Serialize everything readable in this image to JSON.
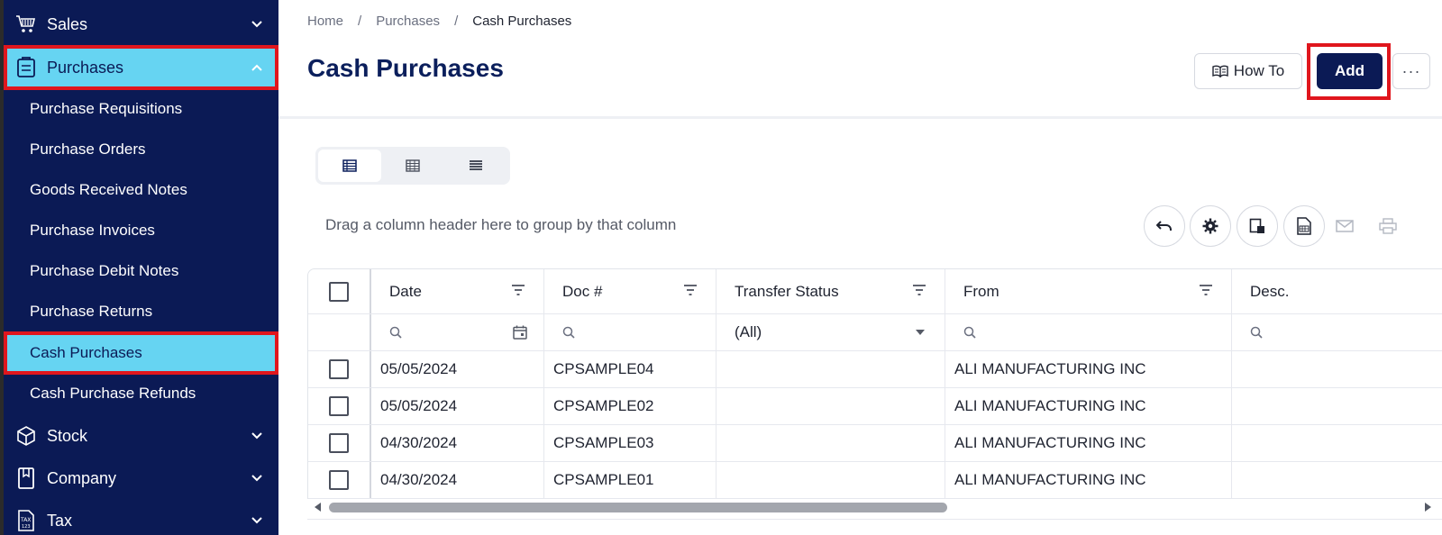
{
  "sidebar": {
    "sections": [
      {
        "label": "Sales",
        "icon": "cart-icon",
        "expanded": false
      },
      {
        "label": "Purchases",
        "icon": "clipboard-icon",
        "expanded": true,
        "active": true
      },
      {
        "label": "Stock",
        "icon": "box-icon",
        "expanded": false
      },
      {
        "label": "Company",
        "icon": "book-icon",
        "expanded": false
      },
      {
        "label": "Tax",
        "icon": "tax-icon",
        "expanded": false
      }
    ],
    "purchases_items": [
      {
        "label": "Purchase Requisitions"
      },
      {
        "label": "Purchase Orders"
      },
      {
        "label": "Goods Received Notes"
      },
      {
        "label": "Purchase Invoices"
      },
      {
        "label": "Purchase Debit Notes"
      },
      {
        "label": "Purchase Returns"
      },
      {
        "label": "Cash Purchases",
        "active": true
      },
      {
        "label": "Cash Purchase Refunds"
      }
    ]
  },
  "breadcrumb": {
    "items": [
      "Home",
      "Purchases",
      "Cash Purchases"
    ],
    "separator": "/"
  },
  "page": {
    "title": "Cash Purchases",
    "howto_label": "How To",
    "add_label": "Add",
    "more_label": "···"
  },
  "view_modes": [
    "standard-view-icon",
    "grid-view-icon",
    "compact-view-icon"
  ],
  "toolbar": {
    "group_hint": "Drag a column header here to group by that column",
    "icons": [
      "undo-icon",
      "settings-icon",
      "column-chooser-icon",
      "export-excel-icon",
      "email-icon",
      "print-icon"
    ]
  },
  "grid": {
    "columns": [
      "Date",
      "Doc #",
      "Transfer Status",
      "From",
      "Desc."
    ],
    "filter": {
      "transfer_status": "(All)"
    },
    "rows": [
      {
        "date": "05/05/2024",
        "doc": "CPSAMPLE04",
        "transfer_status": "",
        "from": "ALI MANUFACTURING INC",
        "desc": ""
      },
      {
        "date": "05/05/2024",
        "doc": "CPSAMPLE02",
        "transfer_status": "",
        "from": "ALI MANUFACTURING INC",
        "desc": ""
      },
      {
        "date": "04/30/2024",
        "doc": "CPSAMPLE03",
        "transfer_status": "",
        "from": "ALI MANUFACTURING INC",
        "desc": ""
      },
      {
        "date": "04/30/2024",
        "doc": "CPSAMPLE01",
        "transfer_status": "",
        "from": "ALI MANUFACTURING INC",
        "desc": ""
      }
    ]
  },
  "colors": {
    "sidebar_bg": "#0b1a55",
    "active_bg": "#66d4f2",
    "highlight_border": "#e0161d",
    "link": "#1aa8e8",
    "primary": "#0b1a55"
  }
}
